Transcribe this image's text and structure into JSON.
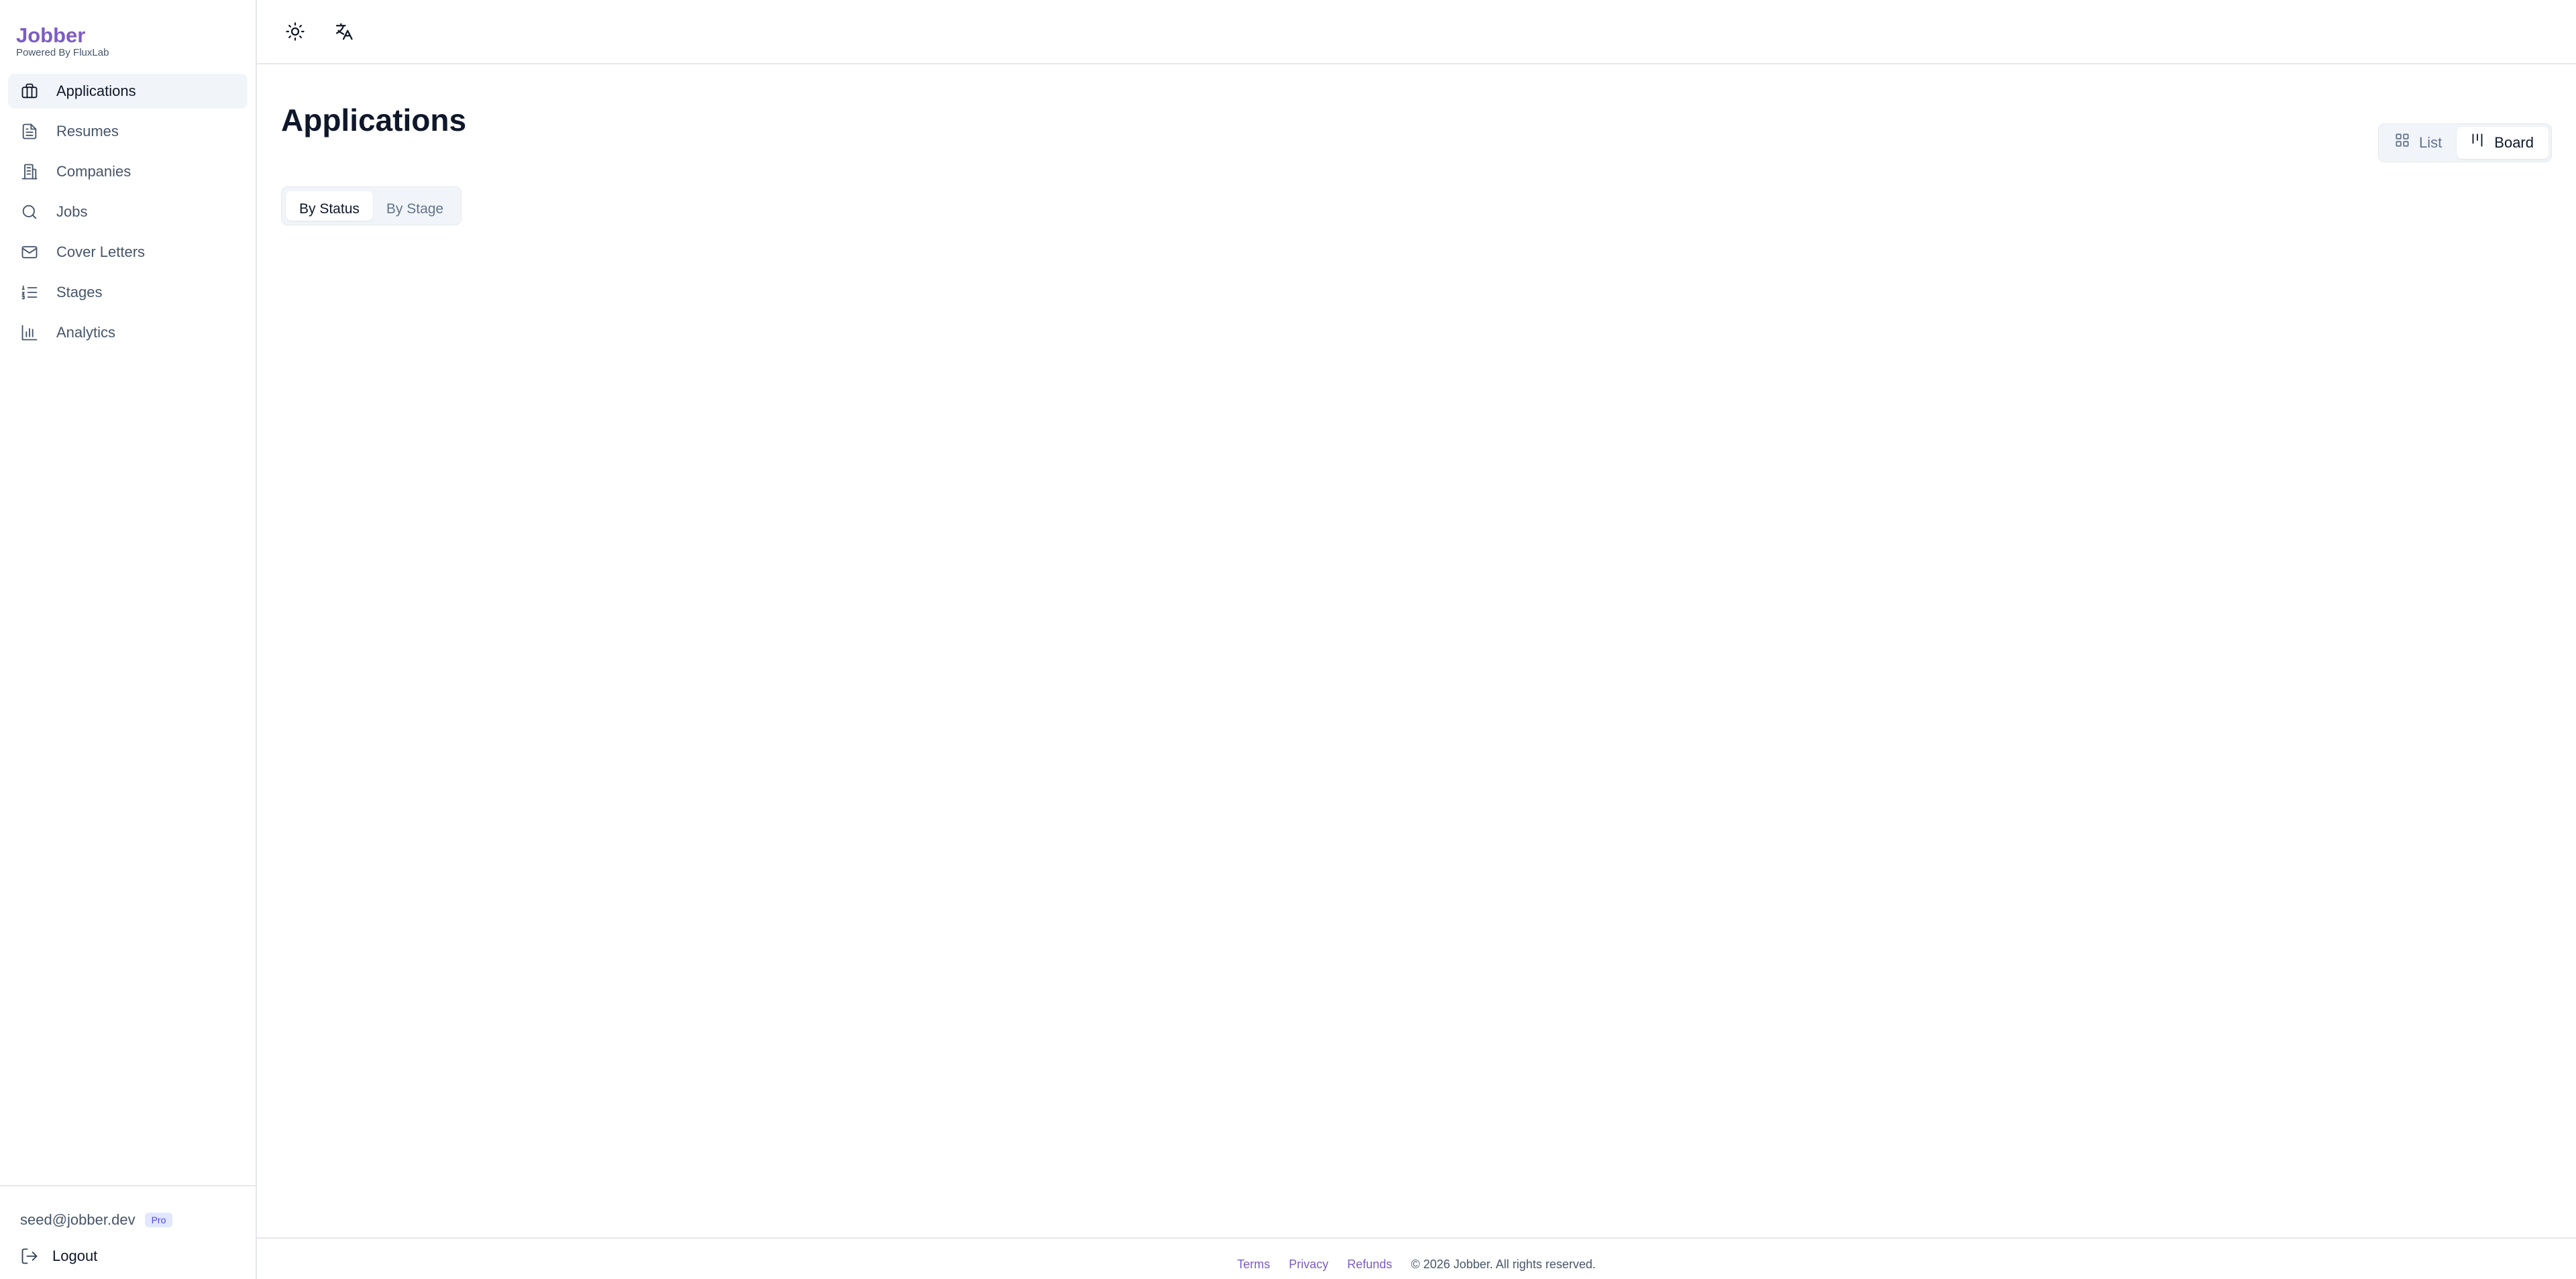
{
  "brand": {
    "title": "Jobber",
    "subtitle": "Powered By FluxLab",
    "color": "#7c5cc4"
  },
  "sidebar": {
    "items": [
      {
        "label": "Applications",
        "icon": "briefcase-icon",
        "active": true
      },
      {
        "label": "Resumes",
        "icon": "file-text-icon"
      },
      {
        "label": "Companies",
        "icon": "building-icon"
      },
      {
        "label": "Jobs",
        "icon": "search-icon"
      },
      {
        "label": "Cover Letters",
        "icon": "mail-icon"
      },
      {
        "label": "Stages",
        "icon": "list-ordered-icon"
      },
      {
        "label": "Analytics",
        "icon": "bar-chart-icon"
      }
    ],
    "user": {
      "email": "seed@jobber.dev",
      "plan": "Pro"
    },
    "logout_label": "Logout"
  },
  "topbar": {
    "theme_icon": "sun-icon",
    "language_icon": "translate-icon"
  },
  "main": {
    "title": "Applications",
    "view_toggle": {
      "list_label": "List",
      "board_label": "Board",
      "selected": "Board"
    },
    "tabs": [
      {
        "label": "By Status",
        "active": true
      },
      {
        "label": "By Stage"
      }
    ]
  },
  "footer": {
    "terms": "Terms",
    "privacy": "Privacy",
    "refunds": "Refunds",
    "copyright": "© 2026 Jobber. All rights reserved."
  }
}
